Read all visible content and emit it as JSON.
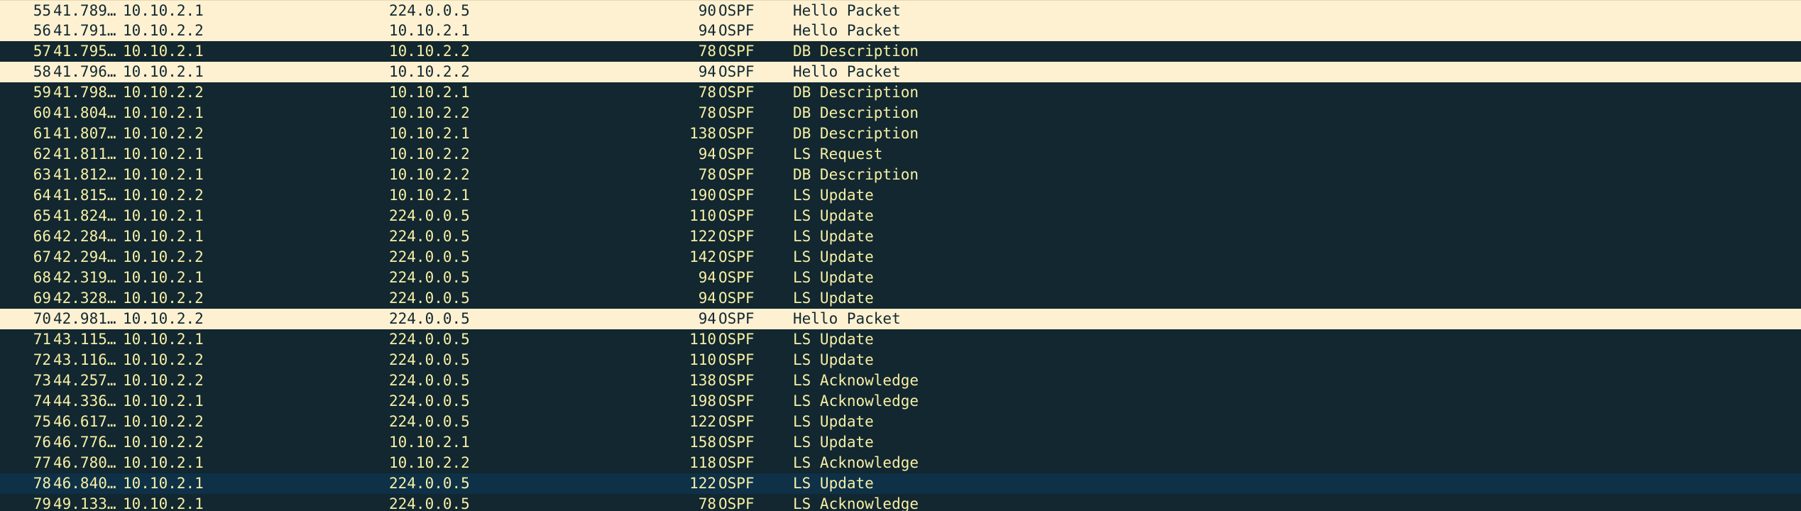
{
  "packet_list": {
    "rows": [
      {
        "no": "55",
        "time": "41.789…",
        "source": "10.10.2.1",
        "destination": "224.0.0.5",
        "length": "90",
        "protocol": "OSPF",
        "info": "Hello Packet",
        "style": "hello"
      },
      {
        "no": "56",
        "time": "41.791…",
        "source": "10.10.2.2",
        "destination": "10.10.2.1",
        "length": "94",
        "protocol": "OSPF",
        "info": "Hello Packet",
        "style": "hello"
      },
      {
        "no": "57",
        "time": "41.795…",
        "source": "10.10.2.1",
        "destination": "10.10.2.2",
        "length": "78",
        "protocol": "OSPF",
        "info": "DB Description",
        "style": "dark"
      },
      {
        "no": "58",
        "time": "41.796…",
        "source": "10.10.2.1",
        "destination": "10.10.2.2",
        "length": "94",
        "protocol": "OSPF",
        "info": "Hello Packet",
        "style": "hello"
      },
      {
        "no": "59",
        "time": "41.798…",
        "source": "10.10.2.2",
        "destination": "10.10.2.1",
        "length": "78",
        "protocol": "OSPF",
        "info": "DB Description",
        "style": "dark"
      },
      {
        "no": "60",
        "time": "41.804…",
        "source": "10.10.2.1",
        "destination": "10.10.2.2",
        "length": "78",
        "protocol": "OSPF",
        "info": "DB Description",
        "style": "dark"
      },
      {
        "no": "61",
        "time": "41.807…",
        "source": "10.10.2.2",
        "destination": "10.10.2.1",
        "length": "138",
        "protocol": "OSPF",
        "info": "DB Description",
        "style": "dark"
      },
      {
        "no": "62",
        "time": "41.811…",
        "source": "10.10.2.1",
        "destination": "10.10.2.2",
        "length": "94",
        "protocol": "OSPF",
        "info": "LS Request",
        "style": "dark"
      },
      {
        "no": "63",
        "time": "41.812…",
        "source": "10.10.2.1",
        "destination": "10.10.2.2",
        "length": "78",
        "protocol": "OSPF",
        "info": "DB Description",
        "style": "dark"
      },
      {
        "no": "64",
        "time": "41.815…",
        "source": "10.10.2.2",
        "destination": "10.10.2.1",
        "length": "190",
        "protocol": "OSPF",
        "info": "LS Update",
        "style": "dark"
      },
      {
        "no": "65",
        "time": "41.824…",
        "source": "10.10.2.1",
        "destination": "224.0.0.5",
        "length": "110",
        "protocol": "OSPF",
        "info": "LS Update",
        "style": "dark"
      },
      {
        "no": "66",
        "time": "42.284…",
        "source": "10.10.2.1",
        "destination": "224.0.0.5",
        "length": "122",
        "protocol": "OSPF",
        "info": "LS Update",
        "style": "dark"
      },
      {
        "no": "67",
        "time": "42.294…",
        "source": "10.10.2.2",
        "destination": "224.0.0.5",
        "length": "142",
        "protocol": "OSPF",
        "info": "LS Update",
        "style": "dark"
      },
      {
        "no": "68",
        "time": "42.319…",
        "source": "10.10.2.1",
        "destination": "224.0.0.5",
        "length": "94",
        "protocol": "OSPF",
        "info": "LS Update",
        "style": "dark"
      },
      {
        "no": "69",
        "time": "42.328…",
        "source": "10.10.2.2",
        "destination": "224.0.0.5",
        "length": "94",
        "protocol": "OSPF",
        "info": "LS Update",
        "style": "dark"
      },
      {
        "no": "70",
        "time": "42.981…",
        "source": "10.10.2.2",
        "destination": "224.0.0.5",
        "length": "94",
        "protocol": "OSPF",
        "info": "Hello Packet",
        "style": "hello"
      },
      {
        "no": "71",
        "time": "43.115…",
        "source": "10.10.2.1",
        "destination": "224.0.0.5",
        "length": "110",
        "protocol": "OSPF",
        "info": "LS Update",
        "style": "dark"
      },
      {
        "no": "72",
        "time": "43.116…",
        "source": "10.10.2.2",
        "destination": "224.0.0.5",
        "length": "110",
        "protocol": "OSPF",
        "info": "LS Update",
        "style": "dark"
      },
      {
        "no": "73",
        "time": "44.257…",
        "source": "10.10.2.2",
        "destination": "224.0.0.5",
        "length": "138",
        "protocol": "OSPF",
        "info": "LS Acknowledge",
        "style": "dark"
      },
      {
        "no": "74",
        "time": "44.336…",
        "source": "10.10.2.1",
        "destination": "224.0.0.5",
        "length": "198",
        "protocol": "OSPF",
        "info": "LS Acknowledge",
        "style": "dark"
      },
      {
        "no": "75",
        "time": "46.617…",
        "source": "10.10.2.2",
        "destination": "224.0.0.5",
        "length": "122",
        "protocol": "OSPF",
        "info": "LS Update",
        "style": "dark"
      },
      {
        "no": "76",
        "time": "46.776…",
        "source": "10.10.2.2",
        "destination": "10.10.2.1",
        "length": "158",
        "protocol": "OSPF",
        "info": "LS Update",
        "style": "dark"
      },
      {
        "no": "77",
        "time": "46.780…",
        "source": "10.10.2.1",
        "destination": "10.10.2.2",
        "length": "118",
        "protocol": "OSPF",
        "info": "LS Acknowledge",
        "style": "dark"
      },
      {
        "no": "78",
        "time": "46.840…",
        "source": "10.10.2.1",
        "destination": "224.0.0.5",
        "length": "122",
        "protocol": "OSPF",
        "info": "LS Update",
        "style": "selected"
      },
      {
        "no": "79",
        "time": "49.133…",
        "source": "10.10.2.1",
        "destination": "224.0.0.5",
        "length": "78",
        "protocol": "OSPF",
        "info": "LS Acknowledge",
        "style": "dark"
      }
    ],
    "colors": {
      "dark_bg": "#12272f",
      "dark_fg": "#f7efa6",
      "hello_bg": "#fdf1d2",
      "hello_fg": "#12272f",
      "selected_bg": "#0e3148"
    }
  }
}
